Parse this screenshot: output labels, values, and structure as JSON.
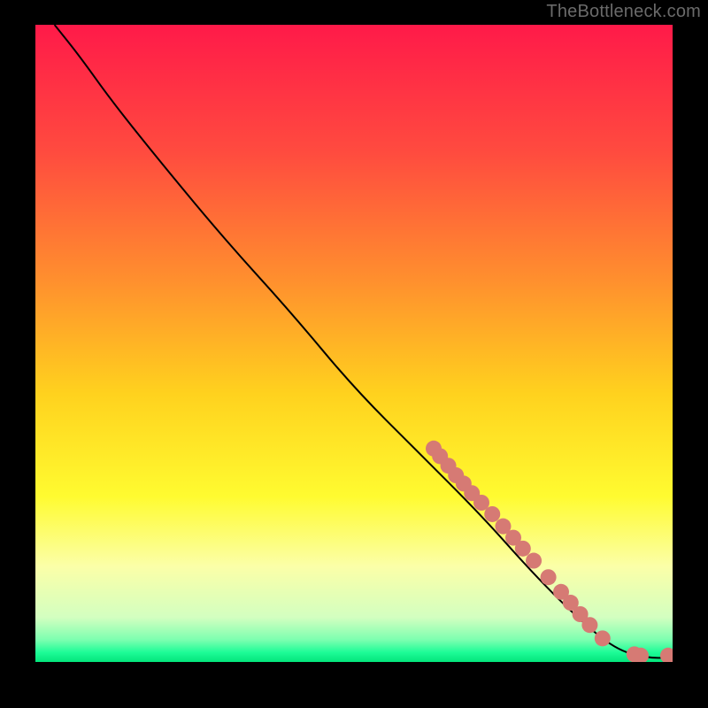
{
  "attribution": "TheBottleneck.com",
  "chart_data": {
    "type": "line",
    "title": "",
    "xlabel": "",
    "ylabel": "",
    "xlim": [
      0,
      100
    ],
    "ylim": [
      0,
      100
    ],
    "grid": false,
    "background_gradient": {
      "stops": [
        {
          "pos": 0.0,
          "color": "#ff1a49"
        },
        {
          "pos": 0.2,
          "color": "#ff4b3f"
        },
        {
          "pos": 0.4,
          "color": "#ff8f2e"
        },
        {
          "pos": 0.58,
          "color": "#ffd21e"
        },
        {
          "pos": 0.74,
          "color": "#fffb30"
        },
        {
          "pos": 0.85,
          "color": "#fbffa8"
        },
        {
          "pos": 0.93,
          "color": "#d3ffc0"
        },
        {
          "pos": 0.965,
          "color": "#7dffb0"
        },
        {
          "pos": 0.985,
          "color": "#1dfc97"
        },
        {
          "pos": 1.0,
          "color": "#03e47b"
        }
      ]
    },
    "curve": [
      {
        "x": 3,
        "y": 100
      },
      {
        "x": 7,
        "y": 95
      },
      {
        "x": 12,
        "y": 88
      },
      {
        "x": 20,
        "y": 78
      },
      {
        "x": 30,
        "y": 66
      },
      {
        "x": 40,
        "y": 55
      },
      {
        "x": 50,
        "y": 43
      },
      {
        "x": 60,
        "y": 33
      },
      {
        "x": 70,
        "y": 23
      },
      {
        "x": 78,
        "y": 14
      },
      {
        "x": 85,
        "y": 7
      },
      {
        "x": 91,
        "y": 2
      },
      {
        "x": 96,
        "y": 0.6
      },
      {
        "x": 100,
        "y": 0.7
      }
    ],
    "points": [
      {
        "x": 62.5,
        "y": 33.5
      },
      {
        "x": 63.5,
        "y": 32.3
      },
      {
        "x": 64.8,
        "y": 30.8
      },
      {
        "x": 66.0,
        "y": 29.3
      },
      {
        "x": 67.2,
        "y": 28.0
      },
      {
        "x": 68.5,
        "y": 26.5
      },
      {
        "x": 70.0,
        "y": 25.0
      },
      {
        "x": 71.7,
        "y": 23.2
      },
      {
        "x": 73.4,
        "y": 21.3
      },
      {
        "x": 75.0,
        "y": 19.5
      },
      {
        "x": 76.5,
        "y": 17.8
      },
      {
        "x": 78.2,
        "y": 15.9
      },
      {
        "x": 80.5,
        "y": 13.3
      },
      {
        "x": 82.5,
        "y": 11.0
      },
      {
        "x": 84.0,
        "y": 9.3
      },
      {
        "x": 85.5,
        "y": 7.5
      },
      {
        "x": 87.0,
        "y": 5.8
      },
      {
        "x": 89.0,
        "y": 3.7
      },
      {
        "x": 94.0,
        "y": 1.2
      },
      {
        "x": 95.0,
        "y": 1.0
      },
      {
        "x": 99.3,
        "y": 1.0
      }
    ],
    "point_color": "#d67a74",
    "point_radius": 9,
    "line_color": "#000000",
    "line_width": 2
  }
}
